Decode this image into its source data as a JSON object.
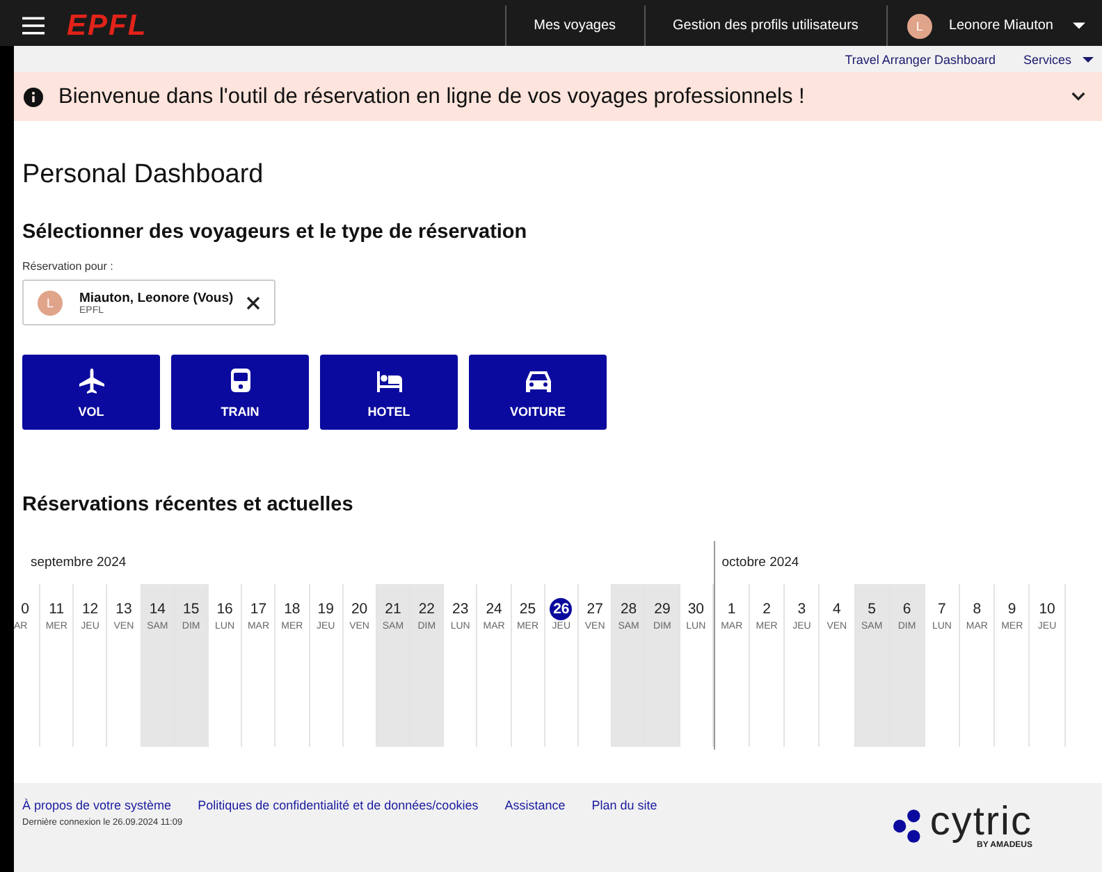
{
  "header": {
    "logo": "EPFL",
    "nav": [
      "Mes voyages",
      "Gestion des profils utilisateurs"
    ],
    "user": {
      "initial": "L",
      "name": "Leonore Miauton"
    }
  },
  "subnav": [
    {
      "label": "Travel Arranger Dashboard",
      "dropdown": false
    },
    {
      "label": "Services",
      "dropdown": true
    }
  ],
  "banner": {
    "text": "Bienvenue dans l'outil de réservation en ligne de vos voyages professionnels !",
    "expanded": false
  },
  "title": "Personal Dashboard",
  "selection": {
    "heading": "Sélectionner des voyageurs et le type de réservation",
    "label": "Réservation pour :",
    "traveler": {
      "initial": "L",
      "name": "Miauton, Leonore (Vous)",
      "company": "EPFL"
    },
    "types": [
      {
        "kind": "flight",
        "label": "VOL"
      },
      {
        "kind": "train",
        "label": "TRAIN"
      },
      {
        "kind": "hotel",
        "label": "HOTEL"
      },
      {
        "kind": "car",
        "label": "VOITURE"
      }
    ]
  },
  "reservations": {
    "heading": "Réservations récentes et actuelles",
    "months": [
      {
        "label": "septembre 2024",
        "days": [
          {
            "num": "0",
            "dow": "AR",
            "weekend": false,
            "selected": false
          },
          {
            "num": "11",
            "dow": "MER",
            "weekend": false,
            "selected": false
          },
          {
            "num": "12",
            "dow": "JEU",
            "weekend": false,
            "selected": false
          },
          {
            "num": "13",
            "dow": "VEN",
            "weekend": false,
            "selected": false
          },
          {
            "num": "14",
            "dow": "SAM",
            "weekend": true,
            "selected": false
          },
          {
            "num": "15",
            "dow": "DIM",
            "weekend": true,
            "selected": false
          },
          {
            "num": "16",
            "dow": "LUN",
            "weekend": false,
            "selected": false
          },
          {
            "num": "17",
            "dow": "MAR",
            "weekend": false,
            "selected": false
          },
          {
            "num": "18",
            "dow": "MER",
            "weekend": false,
            "selected": false
          },
          {
            "num": "19",
            "dow": "JEU",
            "weekend": false,
            "selected": false
          },
          {
            "num": "20",
            "dow": "VEN",
            "weekend": false,
            "selected": false
          },
          {
            "num": "21",
            "dow": "SAM",
            "weekend": true,
            "selected": false
          },
          {
            "num": "22",
            "dow": "DIM",
            "weekend": true,
            "selected": false
          },
          {
            "num": "23",
            "dow": "LUN",
            "weekend": false,
            "selected": false
          },
          {
            "num": "24",
            "dow": "MAR",
            "weekend": false,
            "selected": false
          },
          {
            "num": "25",
            "dow": "MER",
            "weekend": false,
            "selected": false
          },
          {
            "num": "26",
            "dow": "JEU",
            "weekend": false,
            "selected": true
          },
          {
            "num": "27",
            "dow": "VEN",
            "weekend": false,
            "selected": false
          },
          {
            "num": "28",
            "dow": "SAM",
            "weekend": true,
            "selected": false
          },
          {
            "num": "29",
            "dow": "DIM",
            "weekend": true,
            "selected": false
          },
          {
            "num": "30",
            "dow": "LUN",
            "weekend": false,
            "selected": false
          }
        ]
      },
      {
        "label": "octobre 2024",
        "days": [
          {
            "num": "1",
            "dow": "MAR",
            "weekend": false,
            "selected": false
          },
          {
            "num": "2",
            "dow": "MER",
            "weekend": false,
            "selected": false
          },
          {
            "num": "3",
            "dow": "JEU",
            "weekend": false,
            "selected": false
          },
          {
            "num": "4",
            "dow": "VEN",
            "weekend": false,
            "selected": false
          },
          {
            "num": "5",
            "dow": "SAM",
            "weekend": true,
            "selected": false
          },
          {
            "num": "6",
            "dow": "DIM",
            "weekend": true,
            "selected": false
          },
          {
            "num": "7",
            "dow": "LUN",
            "weekend": false,
            "selected": false
          },
          {
            "num": "8",
            "dow": "MAR",
            "weekend": false,
            "selected": false
          },
          {
            "num": "9",
            "dow": "MER",
            "weekend": false,
            "selected": false
          },
          {
            "num": "10",
            "dow": "JEU",
            "weekend": false,
            "selected": false
          }
        ]
      }
    ]
  },
  "footer": {
    "links": [
      "À propos de votre système",
      "Politiques de confidentialité et de données/cookies",
      "Assistance",
      "Plan du site"
    ],
    "last_login": "Dernière connexion le 26.09.2024 11:09",
    "brand": "cytric",
    "brand_tagline": "BY AMADEUS"
  }
}
